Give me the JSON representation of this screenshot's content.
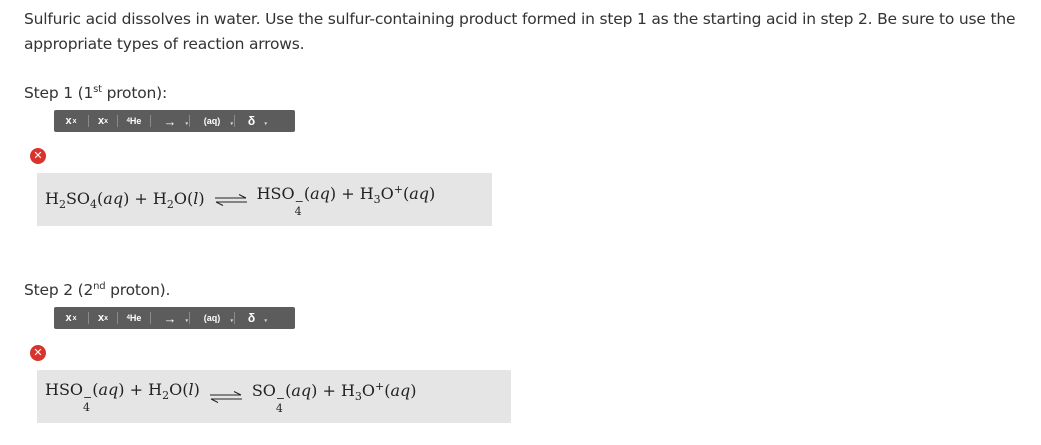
{
  "question": {
    "text": "Sulfuric acid dissolves in water. Use the sulfur-containing product formed in step 1 as the starting acid in step 2.  Be sure to use the appropriate types of reaction arrows."
  },
  "step1": {
    "label_pre": "Step 1 (1",
    "label_sup": "st",
    "label_post": " proton):",
    "status": "incorrect",
    "equation": {
      "r1_a": "H",
      "r1_s1": "2",
      "r1_b": "SO",
      "r1_s2": "4",
      "r1_state": "aq",
      "plus1": "+",
      "r2_a": "H",
      "r2_s1": "2",
      "r2_b": "O",
      "r2_state": "l",
      "p1_a": "HSO",
      "p1_sup": "−",
      "p1_sub": "4",
      "p1_state": "aq",
      "plus2": "+",
      "p2_a": "H",
      "p2_s1": "3",
      "p2_b": "O",
      "p2_sup": "+",
      "p2_state": "aq"
    }
  },
  "step2": {
    "label_pre": "Step 2 (2",
    "label_sup": "nd",
    "label_post": " proton).",
    "status": "incorrect",
    "equation": {
      "r1_a": "HSO",
      "r1_sup": "−",
      "r1_sub": "4",
      "r1_state": "aq",
      "plus1": "+",
      "r2_a": "H",
      "r2_s1": "2",
      "r2_b": "O",
      "r2_state": "l",
      "p1_a": "SO",
      "p1_sup": "−",
      "p1_sub": "4",
      "p1_state": "aq",
      "plus2": "+",
      "p2_a": "H",
      "p2_s1": "3",
      "p2_b": "O",
      "p2_sup": "+",
      "p2_state": "aq"
    }
  },
  "toolbar": {
    "superscript": {
      "main": "x",
      "small": "x"
    },
    "subscript": {
      "main": "x",
      "small": "x"
    },
    "element": {
      "small": "4",
      "main": "He"
    },
    "arrow": "→",
    "state": "(aq)",
    "delta": "δ",
    "caret": "▾"
  },
  "error_icon_glyph": "✕",
  "colors": {
    "toolbar_bg": "#5c5c5c",
    "error_red": "#d9342b",
    "answer_bg": "#e5e5e5"
  }
}
